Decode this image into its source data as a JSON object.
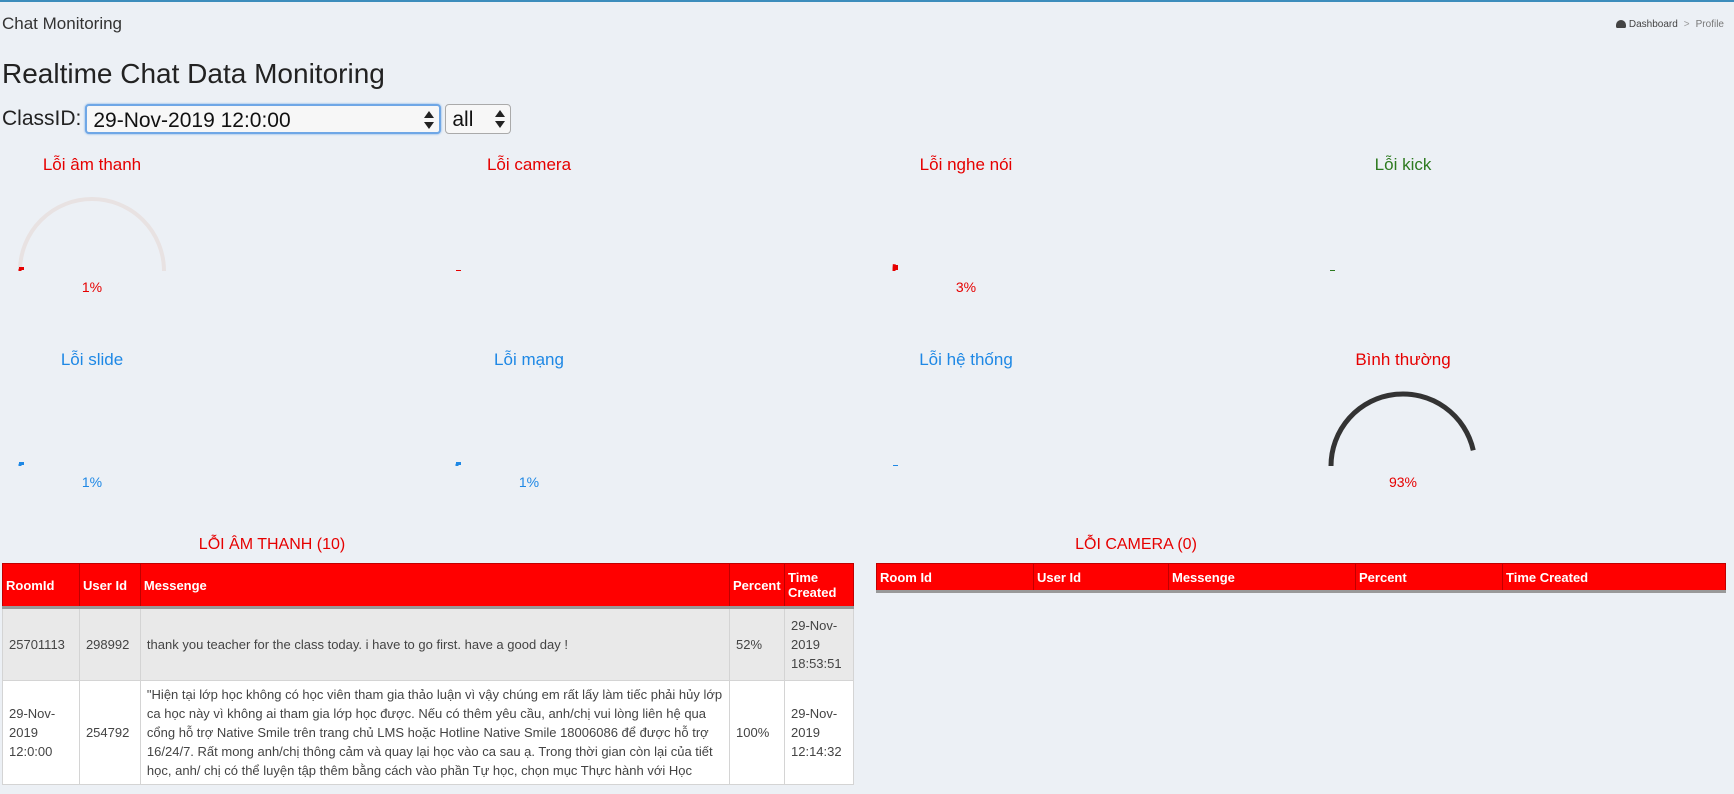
{
  "header": {
    "title": "Chat Monitoring",
    "breadcrumb": [
      "Dashboard",
      "Profile"
    ]
  },
  "main_title": "Realtime Chat Data Monitoring",
  "filter": {
    "label": "ClassID:",
    "class_value": "29-Nov-2019 12:0:00",
    "scope_value": "all"
  },
  "gauges": [
    {
      "title": "Lỗi âm thanh",
      "value": "1%",
      "percent": 1,
      "color": "#e60000"
    },
    {
      "title": "Lỗi camera",
      "value": "",
      "percent": 0,
      "color": "#e60000"
    },
    {
      "title": "Lỗi nghe nói",
      "value": "3%",
      "percent": 3,
      "color": "#e60000"
    },
    {
      "title": "Lỗi kick",
      "value": "",
      "percent": 0,
      "color": "#2d7a1f"
    },
    {
      "title": "Lỗi slide",
      "value": "1%",
      "percent": 1,
      "color": "#1e88e5"
    },
    {
      "title": "Lỗi mạng",
      "value": "1%",
      "percent": 1,
      "color": "#1e88e5"
    },
    {
      "title": "Lỗi hệ thống",
      "value": "",
      "percent": 0,
      "color": "#1e88e5"
    },
    {
      "title": "Bình thường",
      "value": "93%",
      "percent": 93,
      "color": "#e60000",
      "arc_color": "#333333"
    }
  ],
  "audio_table": {
    "title": "LỖI ÂM THANH (10)",
    "headers": [
      "RoomId",
      "User Id",
      "Messenge",
      "Percent",
      "Time Created"
    ],
    "rows": [
      [
        "25701113",
        "298992",
        "thank you teacher for the class today. i have to go first. have a good day !",
        "52%",
        "29-Nov-2019 18:53:51"
      ],
      [
        "29-Nov-2019 12:0:00",
        "254792",
        "\"Hiện tại lớp học không có học viên tham gia thảo luận vì vậy chúng em rất lấy làm tiếc phải hủy lớp ca học này vì không ai tham gia lớp học được. Nếu có thêm yêu cầu, anh/chị vui lòng liên hệ qua cổng hỗ trợ Native Smile trên trang chủ LMS hoặc Hotline Native Smile 18006086 để được hỗ trợ 16/24/7. Rất mong anh/chị thông cảm và quay lại học vào ca sau ạ. Trong thời gian còn lại của tiết học, anh/ chị có thể luyện tập thêm bằng cách vào phần Tự học, chọn mục Thực hành với Học",
        "100%",
        "29-Nov-2019 12:14:32"
      ]
    ]
  },
  "camera_table": {
    "title": "LỖI CAMERA (0)",
    "headers": [
      "Room Id",
      "User Id",
      "Messenge",
      "Percent",
      "Time Created"
    ]
  }
}
